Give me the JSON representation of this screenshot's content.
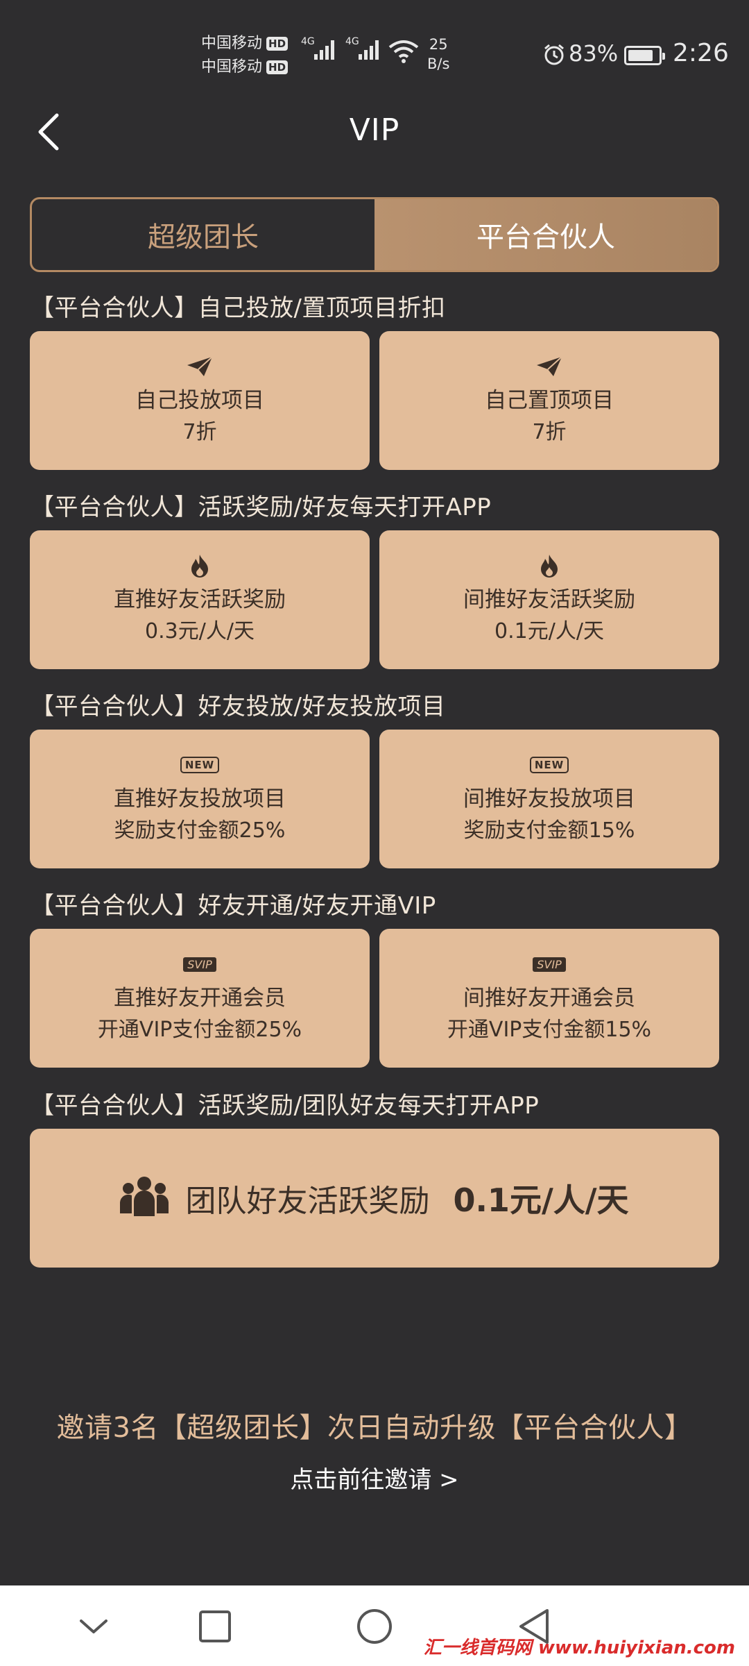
{
  "status_bar": {
    "carrier1": "中国移动",
    "carrier2": "中国移动",
    "hd": "HD",
    "net_type": "4G",
    "speed_value": "25",
    "speed_unit": "B/s",
    "battery_pct": "83%",
    "battery_level": 0.83,
    "time": "2:26",
    "icons": [
      "signal-icon",
      "wifi-icon",
      "alarm-icon",
      "battery-icon"
    ]
  },
  "header": {
    "title": "VIP",
    "back_icon": "chevron-left-icon"
  },
  "tabs": [
    {
      "label": "超级团长",
      "active": false
    },
    {
      "label": "平台合伙人",
      "active": true
    }
  ],
  "sections": [
    {
      "title": "【平台合伙人】自己投放/置顶项目折扣",
      "icon": "paper-plane-icon",
      "cards": [
        {
          "line1": "自己投放项目",
          "line2": "7折"
        },
        {
          "line1": "自己置顶项目",
          "line2": "7折"
        }
      ]
    },
    {
      "title": "【平台合伙人】活跃奖励/好友每天打开APP",
      "icon": "flame-icon",
      "cards": [
        {
          "line1": "直推好友活跃奖励",
          "line2": "0.3元/人/天"
        },
        {
          "line1": "间推好友活跃奖励",
          "line2": "0.1元/人/天"
        }
      ]
    },
    {
      "title": "【平台合伙人】好友投放/好友投放项目",
      "icon": "new-badge-icon",
      "badge": "NEW",
      "cards": [
        {
          "line1": "直推好友投放项目",
          "line2": "奖励支付金额25%"
        },
        {
          "line1": "间推好友投放项目",
          "line2": "奖励支付金额15%"
        }
      ]
    },
    {
      "title": "【平台合伙人】好友开通/好友开通VIP",
      "icon": "svip-badge-icon",
      "badge": "SVIP",
      "cards": [
        {
          "line1": "直推好友开通会员",
          "line2": "开通VIP支付金额25%"
        },
        {
          "line1": "间推好友开通会员",
          "line2": "开通VIP支付金额15%"
        }
      ]
    },
    {
      "title": "【平台合伙人】活跃奖励/团队好友每天打开APP"
    }
  ],
  "team_card": {
    "icon": "team-icon",
    "label": "团队好友活跃奖励",
    "value": "0.1元/人/天"
  },
  "footer": {
    "invite_text": "邀请3名【超级团长】次日自动升级【平台合伙人】",
    "invite_link": "点击前往邀请 >"
  },
  "nav_bar": {
    "icons": [
      "chevron-down-icon",
      "square-icon",
      "circle-icon",
      "triangle-back-icon"
    ]
  },
  "watermark": "汇一线首码网 www.huiyixian.com",
  "colors": {
    "background": "#2e2d2f",
    "card": "#e3bd9a",
    "accent": "#b48a63",
    "card_text": "#3b2f27"
  }
}
